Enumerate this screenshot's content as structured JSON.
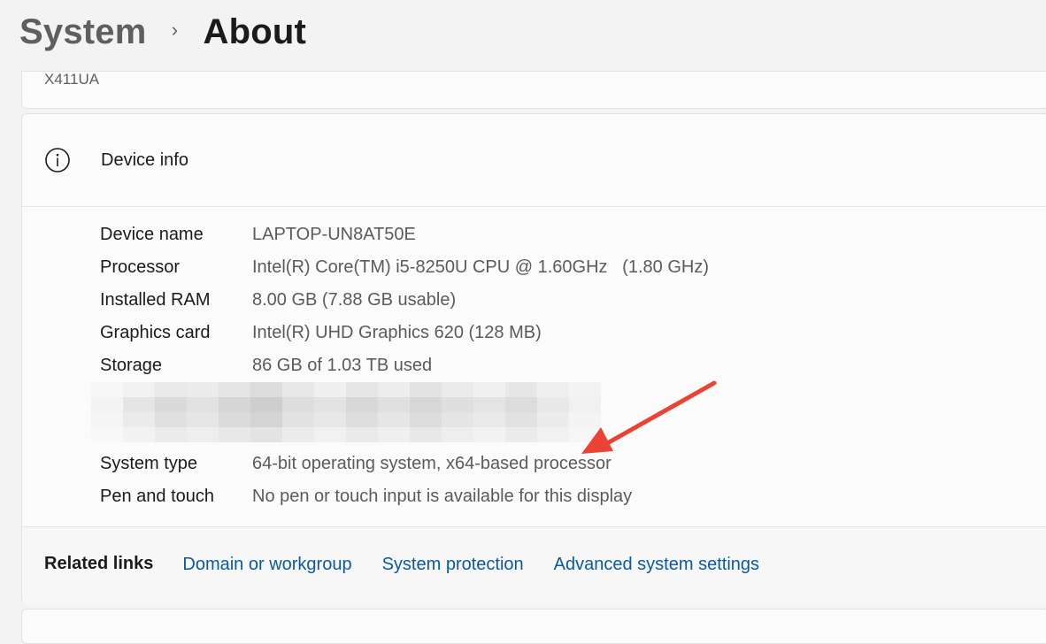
{
  "breadcrumb": {
    "parent": "System",
    "separator": "›",
    "current": "About"
  },
  "device_model": "X411UA",
  "device_info": {
    "title": "Device info",
    "icon": "info-icon",
    "rows": [
      {
        "label": "Device name",
        "value": "LAPTOP-UN8AT50E"
      },
      {
        "label": "Processor",
        "value": "Intel(R) Core(TM) i5-8250U CPU @ 1.60GHz   (1.80 GHz)"
      },
      {
        "label": "Installed RAM",
        "value": "8.00 GB (7.88 GB usable)"
      },
      {
        "label": "Graphics card",
        "value": "Intel(R) UHD Graphics 620 (128 MB)"
      },
      {
        "label": "Storage",
        "value": "86 GB of 1.03 TB used"
      },
      {
        "label": "System type",
        "value": "64-bit operating system, x64-based processor"
      },
      {
        "label": "Pen and touch",
        "value": "No pen or touch input is available for this display"
      }
    ]
  },
  "related_links": {
    "label": "Related links",
    "links": [
      "Domain or workgroup",
      "System protection",
      "Advanced system settings"
    ]
  },
  "colors": {
    "background": "#f3f3f3",
    "card": "#fbfbfb",
    "link": "#0a58a6",
    "annotation_arrow": "#ea4335"
  }
}
